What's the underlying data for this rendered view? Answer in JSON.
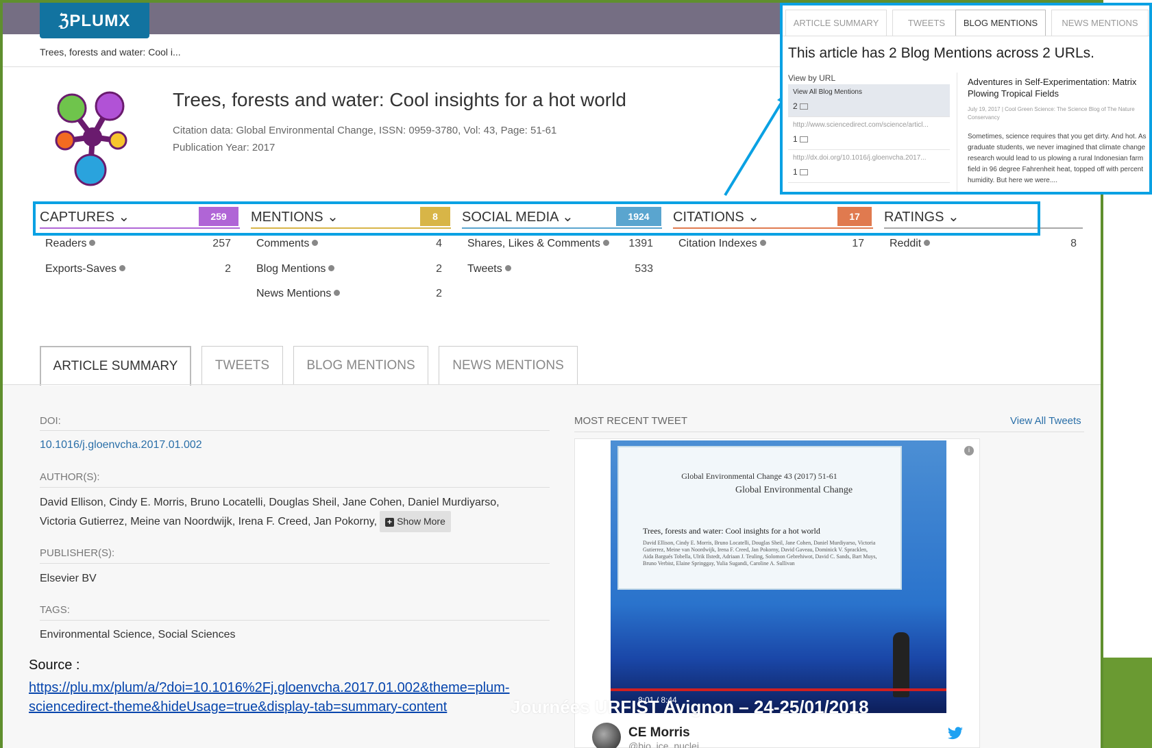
{
  "header": {
    "logo": "ℨPLUMX",
    "breadcrumb": "Trees, forests and water: Cool i..."
  },
  "article": {
    "title": "Trees, forests and water: Cool insights for a hot world",
    "citation": "Citation data: Global Environmental Change, ISSN: 0959-3780, Vol: 43, Page: 51-61",
    "pub_year": "Publication Year: 2017"
  },
  "categories": [
    {
      "label": "CAPTURES ⌄",
      "count": "259",
      "color": "#b065d6"
    },
    {
      "label": "MENTIONS ⌄",
      "count": "8",
      "color": "#d8b547"
    },
    {
      "label": "SOCIAL MEDIA ⌄",
      "count": "1924",
      "color": "#5aa5cf"
    },
    {
      "label": "CITATIONS ⌄",
      "count": "17",
      "color": "#e07a4f"
    },
    {
      "label": "RATINGS ⌄",
      "count": "",
      "color": "#a7a7a7"
    }
  ],
  "metrics": {
    "captures": [
      {
        "label": "Readers",
        "value": "257"
      },
      {
        "label": "Exports-Saves",
        "value": "2"
      }
    ],
    "mentions": [
      {
        "label": "Comments",
        "value": "4"
      },
      {
        "label": "Blog Mentions",
        "value": "2"
      },
      {
        "label": "News Mentions",
        "value": "2"
      }
    ],
    "social": [
      {
        "label": "Shares, Likes & Comments",
        "value": "1391"
      },
      {
        "label": "Tweets",
        "value": "533"
      }
    ],
    "citations": [
      {
        "label": "Citation Indexes",
        "value": "17"
      }
    ],
    "ratings": [
      {
        "label": "Reddit",
        "value": "8"
      }
    ]
  },
  "tabs": [
    "ARTICLE SUMMARY",
    "TWEETS",
    "BLOG MENTIONS",
    "NEWS MENTIONS"
  ],
  "details": {
    "doi_label": "DOI:",
    "doi": "10.1016/j.gloenvcha.2017.01.002",
    "authors_label": "AUTHOR(S):",
    "authors_line1": "David Ellison, Cindy E. Morris, Bruno Locatelli, Douglas Sheil, Jane Cohen, Daniel Murdiyarso,",
    "authors_line2": "Victoria Gutierrez, Meine van Noordwijk, Irena F. Creed, Jan Pokorny,",
    "show_more": "Show More",
    "publisher_label": "PUBLISHER(S):",
    "publisher": "Elsevier BV",
    "tags_label": "TAGS:",
    "tags": "Environmental Science, Social Sciences"
  },
  "tweet": {
    "section_label": "MOST RECENT TWEET",
    "view_all": "View All Tweets",
    "video_time": "8:01 / 8:44",
    "paper_header": "Global Environmental Change 43 (2017) 51-61",
    "paper_journal": "Global Environmental Change",
    "paper_title": "Trees, forests and water: Cool insights for a hot world",
    "paper_authors": "David Ellison, Cindy E. Morris, Bruno Locatelli, Douglas Sheil, Jane Cohen, Daniel Murdiyarso, Victoria Gutierrez, Meine van Noordwijk, Irena F. Creed, Jan Pokorny, David Gaveau, Dominick V. Spracklen, Aida Bargués Tobella, Ulrik Ilstedt, Adriaan J. Teuling, Solomon Gebrehiwot, David C. Sands, Bart Muys, Bruno Verbist, Elaine Springgay, Yulia Sugandi, Caroline A. Sullivan",
    "user": "CE Morris",
    "handle": "@bio_ice_nuclei"
  },
  "footer": {
    "source_label": "Source :",
    "source_url": "https://plu.mx/plum/a/?doi=10.1016%2Fj.gloenvcha.2017.01.002&theme=plum-sciencedirect-theme&hideUsage=true&display-tab=summary-content",
    "event": "Journées URFIST Avignon – 24-25/01/2018"
  },
  "inset": {
    "tabs": [
      "ARTICLE SUMMARY",
      "TWEETS",
      "BLOG MENTIONS",
      "NEWS MENTIONS"
    ],
    "heading": "This article has 2 Blog Mentions across 2 URLs.",
    "view_by": "View by URL",
    "urls": [
      {
        "label": "View All Blog Mentions",
        "count": "2"
      },
      {
        "label": "http://www.sciencedirect.com/science/articl...",
        "count": "1"
      },
      {
        "label": "http://dx.doi.org/10.1016/j.gloenvcha.2017...",
        "count": "1"
      }
    ],
    "blog_title": "Adventures in Self-Experimentation: Matrix Plowing Tropical Fields",
    "blog_meta": "July 19, 2017 | Cool Green Science: The Science Blog of The Nature Conservancy",
    "blog_excerpt": "Sometimes, science requires that you get dirty. And hot. As graduate students, we never imagined that climate change research would lead to us plowing a rural Indonesian farm field in 96 degree Fahrenheit heat, topped off with percent humidity. But here we were...."
  }
}
